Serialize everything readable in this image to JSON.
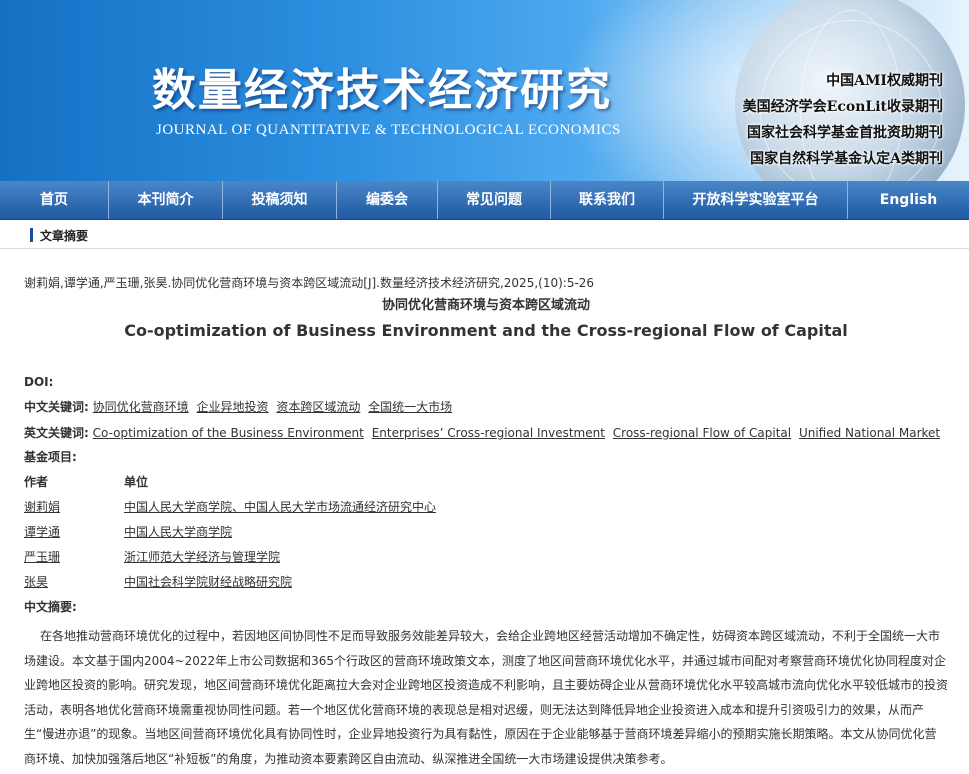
{
  "header": {
    "title_cn": "数量经济技术经济研究",
    "title_en": "JOURNAL OF QUANTITATIVE & TECHNOLOGICAL ECONOMICS",
    "badges": [
      "中国AMI权威期刊",
      "美国经济学会EconLit收录期刊",
      "国家社会科学基金首批资助期刊",
      "国家自然科学基金认定A类期刊"
    ]
  },
  "nav": {
    "items": [
      "首页",
      "本刊简介",
      "投稿须知",
      "编委会",
      "常见问题",
      "联系我们",
      "开放科学实验室平台",
      "English"
    ]
  },
  "breadcrumb": {
    "label": "文章摘要"
  },
  "article": {
    "citation": "谢莉娟,谭学通,严玉珊,张昊.协同优化营商环境与资本跨区域流动[J].数量经济技术经济研究,2025,(10):5-26",
    "title_cn": "协同优化营商环境与资本跨区域流动",
    "title_en": "Co-optimization of Business Environment and the Cross-regional Flow of Capital",
    "doi_label": "DOI:",
    "doi_value": "",
    "kw_cn_label": "中文关键词:",
    "keywords_cn": [
      "协同优化营商环境",
      "企业异地投资",
      "资本跨区域流动",
      "全国统一大市场"
    ],
    "kw_en_label": "英文关键词:",
    "keywords_en": [
      "Co-optimization of the Business Environment",
      "Enterprises’ Cross-regional Investment",
      "Cross-regional Flow of Capital",
      "Unified National Market"
    ],
    "fund_label": "基金项目:",
    "author_header": "作者",
    "unit_header": "单位",
    "authors": [
      {
        "name": "谢莉娟",
        "unit": "中国人民大学商学院、中国人民大学市场流通经济研究中心"
      },
      {
        "name": "谭学通",
        "unit": "中国人民大学商学院"
      },
      {
        "name": "严玉珊",
        "unit": "浙江师范大学经济与管理学院"
      },
      {
        "name": "张昊",
        "unit": "中国社会科学院财经战略研究院"
      }
    ],
    "abstract_label": "中文摘要:",
    "abstract": "在各地推动营商环境优化的过程中，若因地区间协同性不足而导致服务效能差异较大，会给企业跨地区经营活动增加不确定性，妨碍资本跨区域流动，不利于全国统一大市场建设。本文基于国内2004~2022年上市公司数据和365个行政区的营商环境政策文本，测度了地区间营商环境优化水平，并通过城市间配对考察营商环境优化协同程度对企业跨地区投资的影响。研究发现，地区间营商环境优化距离拉大会对企业跨地区投资造成不利影响，且主要妨碍企业从营商环境优化水平较高城市流向优化水平较低城市的投资活动，表明各地优化营商环境需重视协同性问题。若一个地区优化营商环境的表现总是相对迟缓，则无法达到降低异地企业投资进入成本和提升引资吸引力的效果，从而产生“慢进亦退”的现象。当地区间营商环境优化具有协同性时，企业异地投资行为具有黏性，原因在于企业能够基于营商环境差异缩小的预期实施长期策略。本文从协同优化营商环境、加快加强落后地区“补短板”的角度，为推动资本要素跨区自由流动、纵深推进全国统一大市场建设提供决策参考。"
  }
}
